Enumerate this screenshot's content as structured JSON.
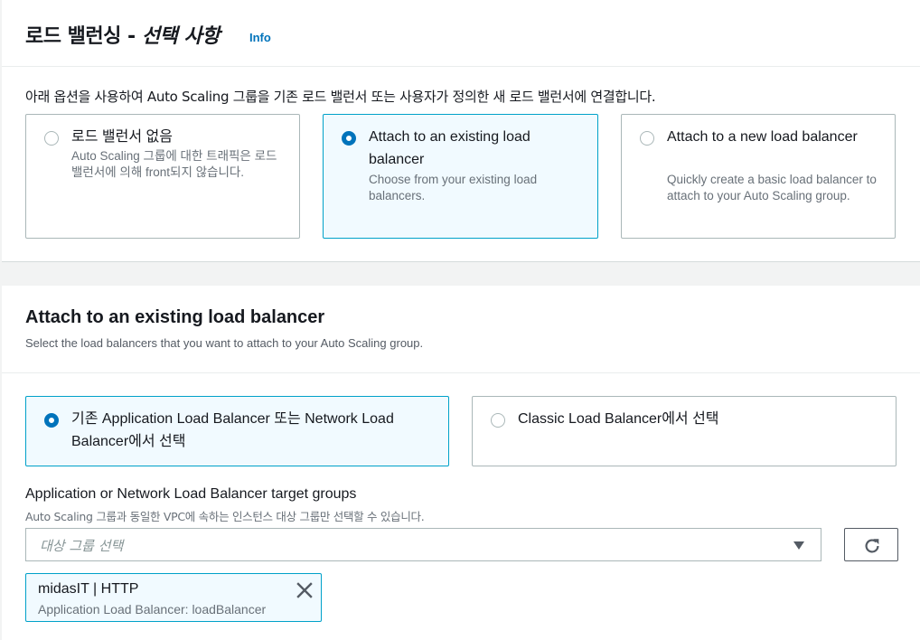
{
  "top_panel": {
    "title_plain": "로드 밸런싱 - ",
    "title_italic": "선택 사항",
    "info": "Info",
    "intro": "아래 옵션을 사용하여 Auto Scaling 그룹을 기존 로드 밸런서 또는 사용자가 정의한 새 로드 밸런서에 연결합니다.",
    "options": [
      {
        "label": "로드 밸런서 없음",
        "desc": "Auto Scaling 그룹에 대한 트래픽은 로드 밸런서에 의해 front되지 않습니다.",
        "selected": false
      },
      {
        "label": "Attach to an existing load balancer",
        "desc": "Choose from your existing load balancers.",
        "selected": true
      },
      {
        "label": "Attach to a new load balancer",
        "desc": "Quickly create a basic load balancer to attach to your Auto Scaling group.",
        "selected": false
      }
    ]
  },
  "existing_lb": {
    "title": "Attach to an existing load balancer",
    "description": "Select the load balancers that you want to attach to your Auto Scaling group.",
    "choices": [
      {
        "label": "기존 Application Load Balancer 또는 Network Load Balancer에서 선택",
        "selected": true
      },
      {
        "label": "Classic Load Balancer에서 선택",
        "selected": false
      }
    ],
    "target_groups": {
      "label": "Application or Network Load Balancer target groups",
      "description": "Auto Scaling 그룹과 동일한 VPC에 속하는 인스턴스 대상 그룹만 선택할 수 있습니다.",
      "placeholder": "대상 그룹 선택",
      "refresh_icon": "refresh-icon",
      "selected_token": {
        "title": "midasIT | HTTP",
        "subtitle": "Application Load Balancer: loadBalancer",
        "remove_icon": "close-icon"
      }
    }
  },
  "colors": {
    "accent": "#0073bb",
    "selected_border": "#00a1c9",
    "selected_bg": "#f1faff",
    "border": "#aab7b8",
    "muted_text": "#687078"
  }
}
